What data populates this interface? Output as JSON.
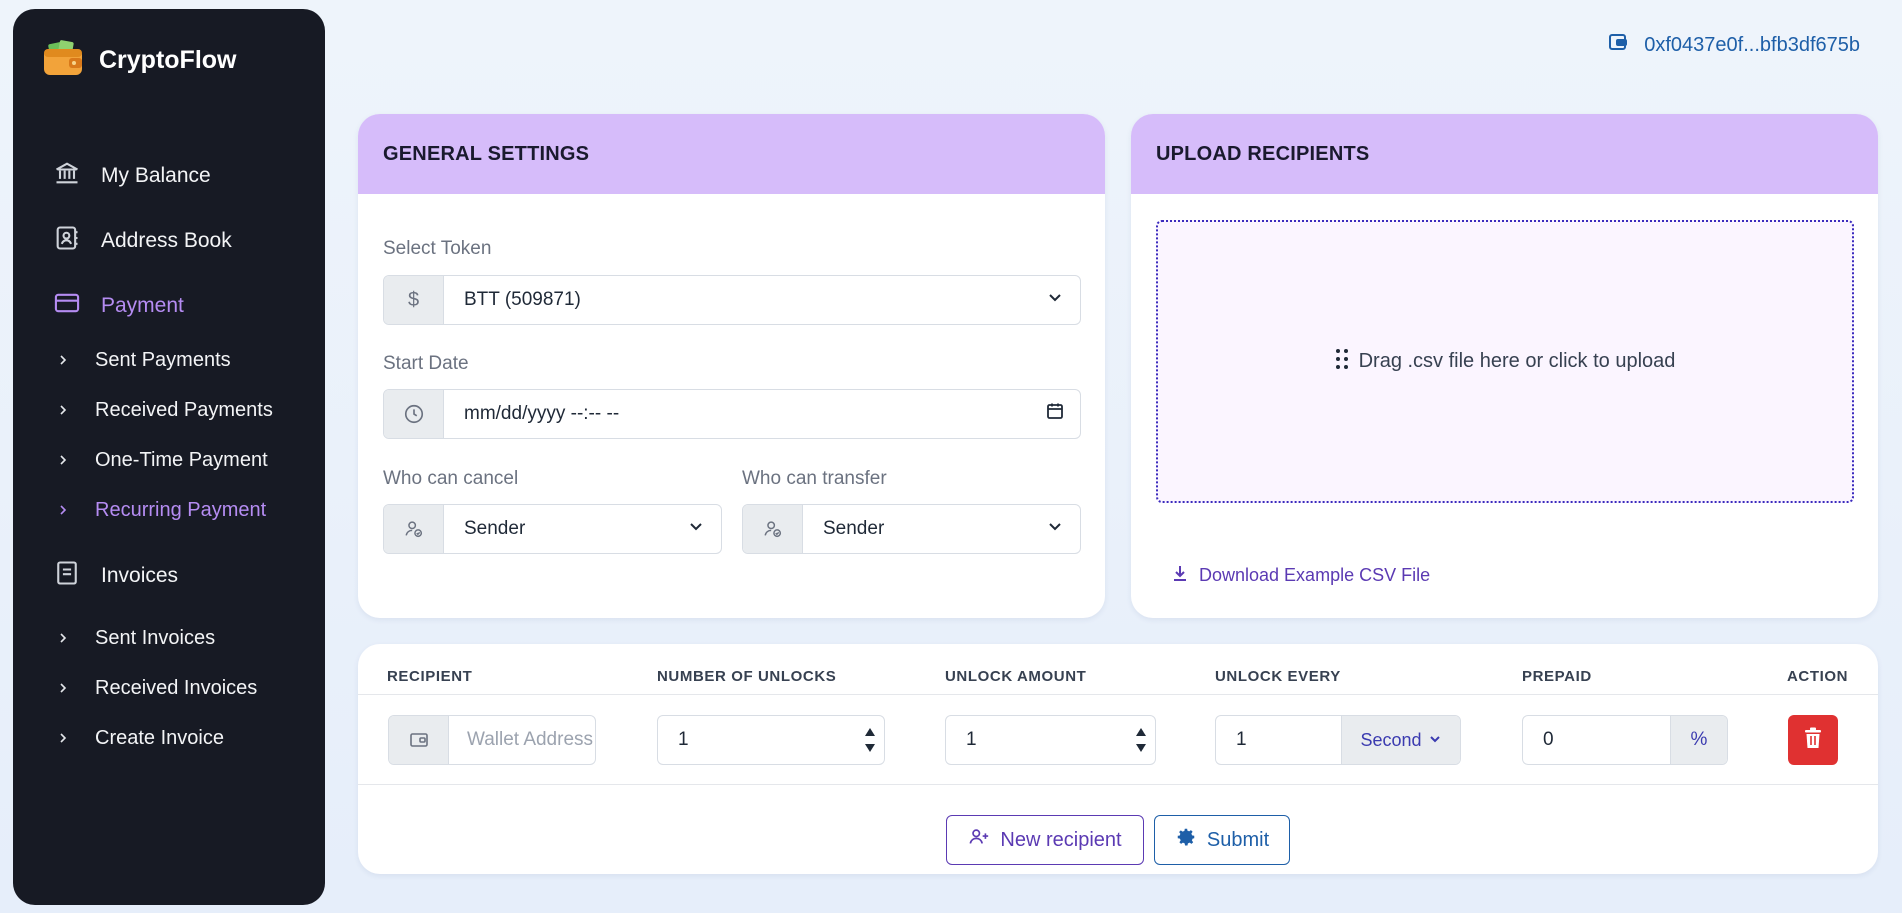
{
  "app": {
    "title": "CryptoFlow",
    "logo_icon": "wallet-icon"
  },
  "wallet": {
    "address": "0xf0437e0f...bfb3df675b",
    "icon": "wallet-icon"
  },
  "sidebar": {
    "items": [
      {
        "label": "My Balance",
        "icon": "bank-icon"
      },
      {
        "label": "Address Book",
        "icon": "contact-book-icon"
      },
      {
        "label": "Payment",
        "icon": "credit-card-icon",
        "active": true
      },
      {
        "label": "Sent Payments"
      },
      {
        "label": "Received Payments"
      },
      {
        "label": "One-Time Payment"
      },
      {
        "label": "Recurring Payment",
        "active": true
      },
      {
        "label": "Invoices",
        "icon": "invoice-icon"
      },
      {
        "label": "Sent Invoices"
      },
      {
        "label": "Received Invoices"
      },
      {
        "label": "Create Invoice"
      }
    ],
    "active_color": "#b58cf2"
  },
  "general": {
    "title": "GENERAL SETTINGS",
    "token_label": "Select Token",
    "token_addon": "$",
    "token_value": "BTT (509871)",
    "start_label": "Start Date",
    "start_value": "mm/dd/yyyy --:-- --",
    "cancel_label": "Who can cancel",
    "cancel_value": "Sender",
    "transfer_label": "Who can transfer",
    "transfer_value": "Sender"
  },
  "upload": {
    "title": "UPLOAD RECIPIENTS",
    "drop_text": "Drag .csv file here or click to upload",
    "download_text": "Download Example CSV File"
  },
  "table": {
    "headers": [
      "RECIPIENT",
      "NUMBER OF UNLOCKS",
      "UNLOCK AMOUNT",
      "UNLOCK EVERY",
      "PREPAID",
      "ACTION"
    ],
    "row": {
      "recipient_placeholder": "Wallet Address",
      "unlocks": "1",
      "amount": "1",
      "every": "1",
      "every_unit": "Second",
      "prepaid": "0",
      "prepaid_unit": "%"
    }
  },
  "actions": {
    "new_recipient": "New recipient",
    "submit": "Submit"
  },
  "colors": {
    "sidebar_bg": "#171a24",
    "card_header": "#d6bcfa",
    "accent_purple": "#5b3ab3",
    "accent_blue": "#1e5fa8",
    "danger": "#e03131"
  }
}
